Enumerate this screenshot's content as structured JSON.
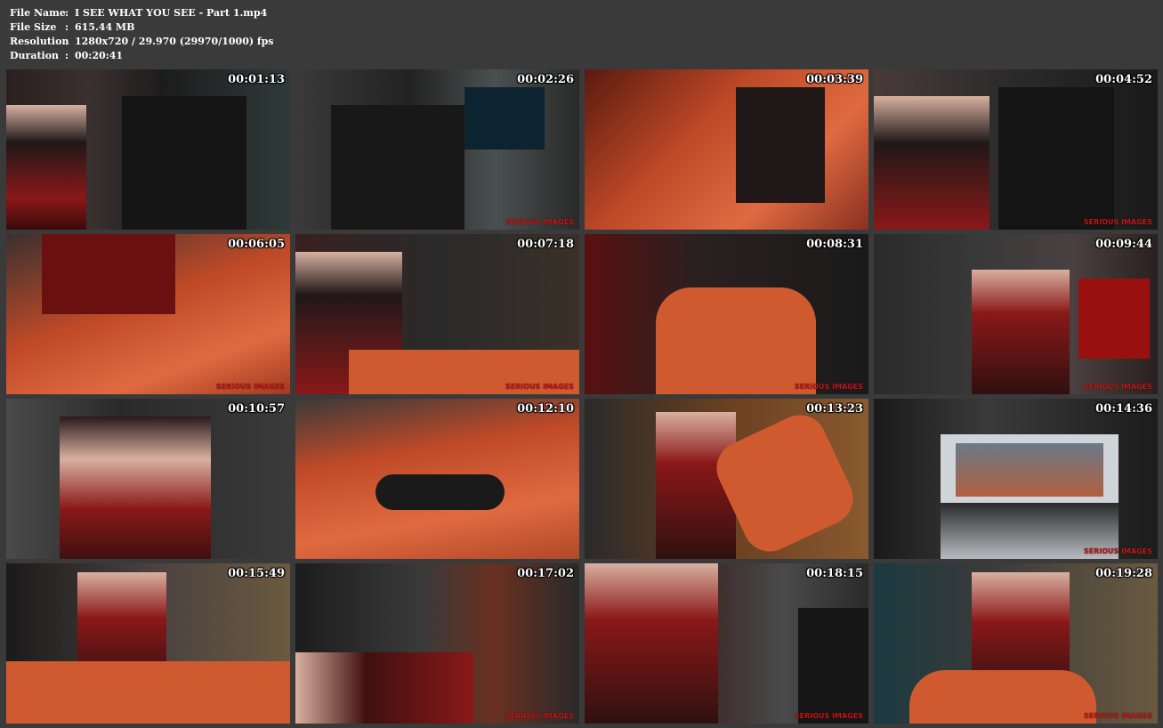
{
  "meta": {
    "rows": [
      {
        "label": "File Name",
        "sep": ":",
        "value": "I SEE WHAT YOU SEE - Part 1.mp4"
      },
      {
        "label": "File Size",
        "sep": ":",
        "value": "615.44 MB"
      },
      {
        "label": "Resolution",
        "sep": ":",
        "value": "1280x720 / 29.970 (29970/1000) fps"
      },
      {
        "label": "Duration",
        "sep": ":",
        "value": "00:20:41"
      }
    ]
  },
  "thumbnails": [
    {
      "timestamp": "00:01:13",
      "watermark": ""
    },
    {
      "timestamp": "00:02:26",
      "watermark": "SERIOUS IMAGES"
    },
    {
      "timestamp": "00:03:39",
      "watermark": ""
    },
    {
      "timestamp": "00:04:52",
      "watermark": "SERIOUS IMAGES"
    },
    {
      "timestamp": "00:06:05",
      "watermark": "SERIOUS IMAGES"
    },
    {
      "timestamp": "00:07:18",
      "watermark": "SERIOUS IMAGES"
    },
    {
      "timestamp": "00:08:31",
      "watermark": "SERIOUS IMAGES"
    },
    {
      "timestamp": "00:09:44",
      "watermark": "SERIOUS IMAGES"
    },
    {
      "timestamp": "00:10:57",
      "watermark": ""
    },
    {
      "timestamp": "00:12:10",
      "watermark": ""
    },
    {
      "timestamp": "00:13:23",
      "watermark": ""
    },
    {
      "timestamp": "00:14:36",
      "watermark": "SERIOUS IMAGES"
    },
    {
      "timestamp": "00:15:49",
      "watermark": ""
    },
    {
      "timestamp": "00:17:02",
      "watermark": "SERIOUS IMAGES"
    },
    {
      "timestamp": "00:18:15",
      "watermark": "SERIOUS IMAGES"
    },
    {
      "timestamp": "00:19:28",
      "watermark": "SERIOUS IMAGES"
    }
  ]
}
